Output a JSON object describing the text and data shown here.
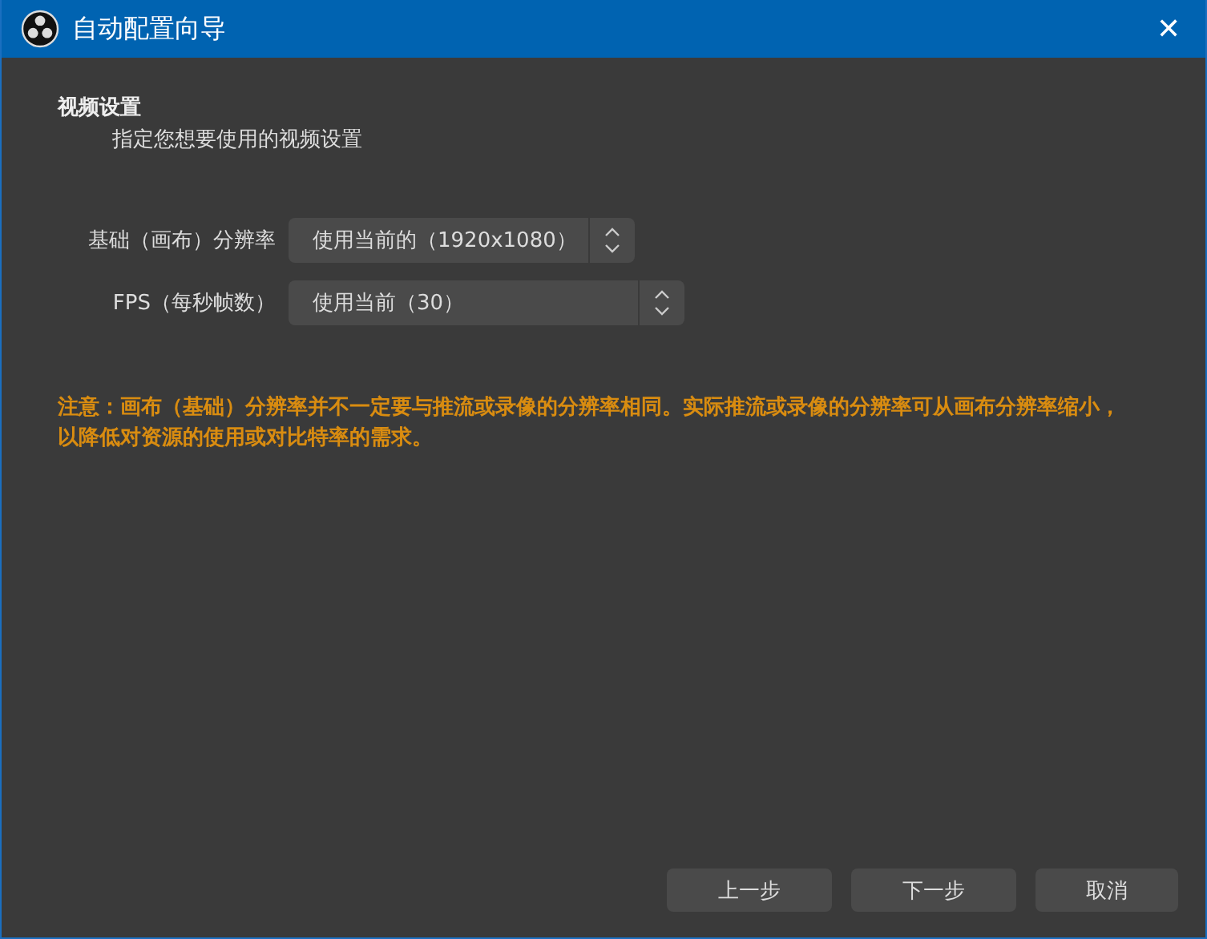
{
  "window": {
    "title": "自动配置向导",
    "close": "✕"
  },
  "section": {
    "title": "视频设置",
    "subtitle": "指定您想要使用的视频设置"
  },
  "fields": [
    {
      "label": "基础（画布）分辨率",
      "value": "使用当前的（1920x1080）"
    },
    {
      "label": "FPS（每秒帧数）",
      "value": "使用当前（30）"
    }
  ],
  "note": "注意：画布（基础）分辨率并不一定要与推流或录像的分辨率相同。实际推流或录像的分辨率可从画布分辨率缩小，以降低对资源的使用或对比特率的需求。",
  "buttons": [
    "上一步",
    "下一步",
    "取消"
  ]
}
